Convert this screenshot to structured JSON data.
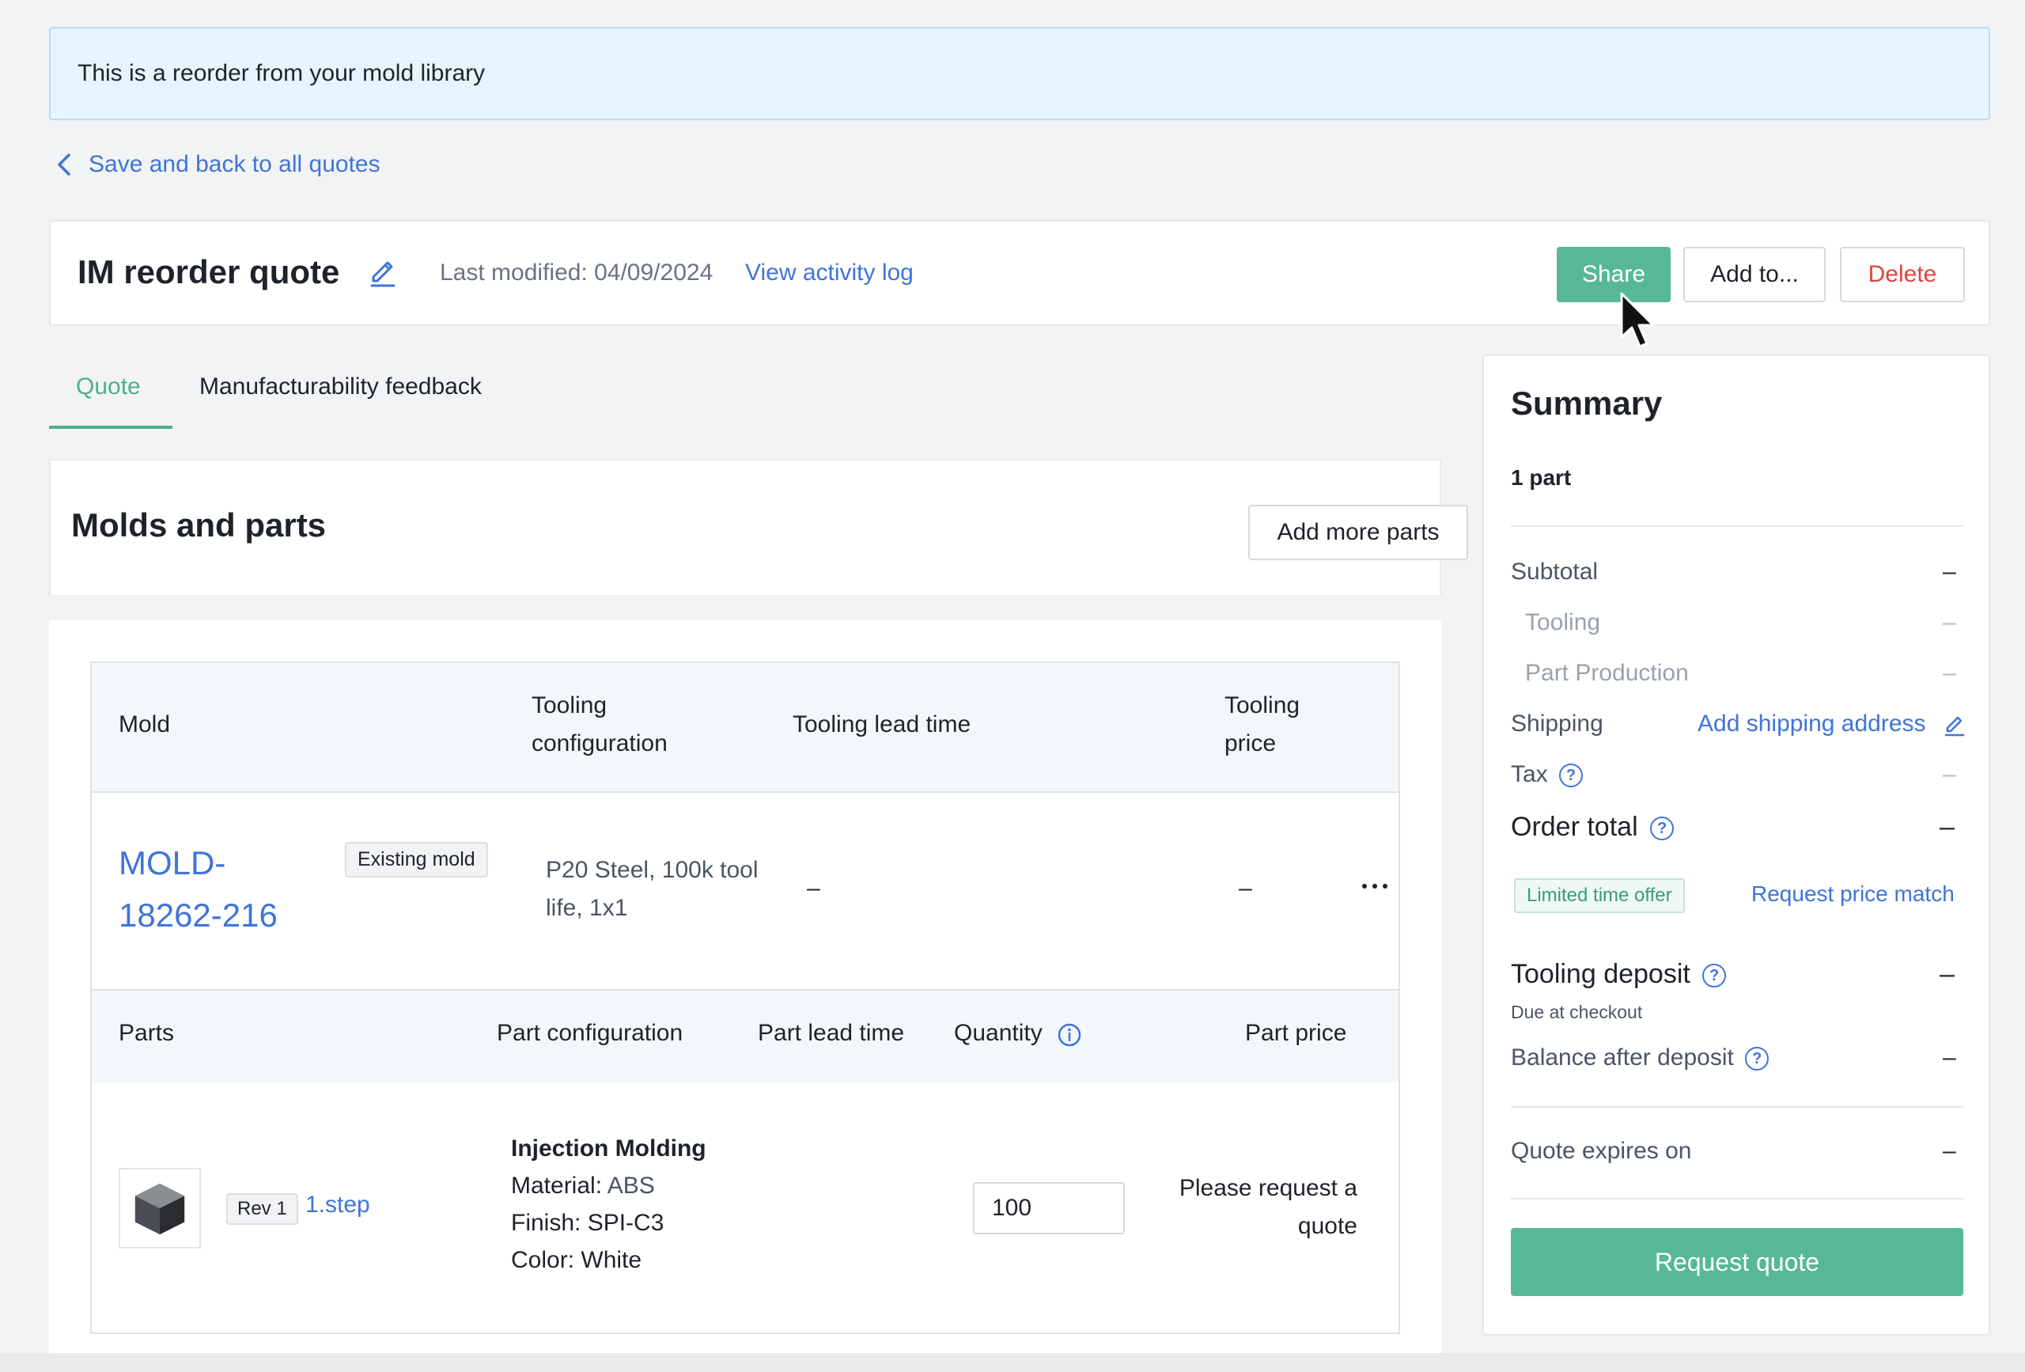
{
  "banner": {
    "text": "This is a reorder from your mold library"
  },
  "back_link": {
    "label": "Save and back to all quotes"
  },
  "header": {
    "title": "IM reorder quote",
    "last_modified": "Last modified: 04/09/2024",
    "activity_link": "View activity log",
    "share_label": "Share",
    "add_to_label": "Add to...",
    "delete_label": "Delete"
  },
  "tabs": [
    {
      "label": "Quote",
      "active": true
    },
    {
      "label": "Manufacturability feedback",
      "active": false
    }
  ],
  "molds": {
    "title": "Molds and parts",
    "add_more_label": "Add more parts",
    "mold_headers": {
      "mold": "Mold",
      "tooling_config": "Tooling configuration",
      "tooling_lead": "Tooling lead time",
      "tooling_price": "Tooling price"
    },
    "mold_row": {
      "id": "MOLD-18262-216",
      "badge": "Existing mold",
      "config": "P20 Steel, 100k tool life, 1x1",
      "lead_time": "–",
      "price": "–"
    },
    "part_headers": {
      "parts": "Parts",
      "part_config": "Part configuration",
      "part_lead": "Part lead time",
      "quantity": "Quantity",
      "part_price": "Part price"
    },
    "part_row": {
      "rev": "Rev 1",
      "file": "1.step",
      "process": "Injection Molding",
      "material_label": "Material:",
      "material": "ABS",
      "finish_label": "Finish:",
      "finish": "SPI-C3",
      "color_label": "Color:",
      "color": "White",
      "quantity": "100",
      "price": "Please request a quote"
    }
  },
  "summary": {
    "title": "Summary",
    "parts_count": "1 part",
    "subtotal": "Subtotal",
    "tooling": "Tooling",
    "part_production": "Part Production",
    "shipping": "Shipping",
    "shipping_link": "Add shipping address",
    "tax": "Tax",
    "order_total": "Order total",
    "offer_badge": "Limited time offer",
    "price_match": "Request price match",
    "tooling_deposit": "Tooling deposit",
    "due_at_checkout": "Due at checkout",
    "balance_after": "Balance after deposit",
    "quote_expires": "Quote expires on",
    "dash": "–",
    "request_quote": "Request quote"
  },
  "colors": {
    "accent_green": "#56b899",
    "link_blue": "#3f74d8",
    "delete_red": "#e2453a",
    "banner_bg": "#e8f4fd"
  },
  "icons": [
    "chevron-left-icon",
    "pencil-icon",
    "mouse-cursor-icon",
    "more-horizontal-icon",
    "info-icon",
    "help-circle-icon",
    "cube-icon"
  ]
}
